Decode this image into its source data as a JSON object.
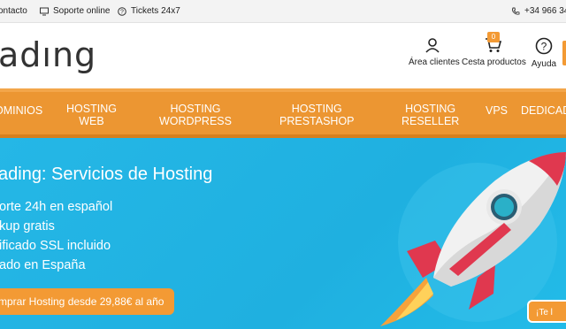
{
  "topbar": {
    "contact": "ontacto",
    "soporte": "Soporte online",
    "tickets": "Tickets 24x7",
    "phone": "+34 966 34"
  },
  "header": {
    "logo": "adıng",
    "area_clientes": "Área clientes",
    "cesta": "Cesta productos",
    "cesta_count": "0",
    "ayuda": "Ayuda"
  },
  "nav": {
    "dominios": "OMINIOS",
    "hosting_web": [
      "HOSTING",
      "WEB"
    ],
    "hosting_wp": [
      "HOSTING",
      "WORDPRESS"
    ],
    "hosting_ps": [
      "HOSTING",
      "PRESTASHOP"
    ],
    "hosting_res": [
      "HOSTING",
      "RESELLER"
    ],
    "vps": "VPS",
    "dedicados": "DEDICAD"
  },
  "hero": {
    "title": "ading: Servicios de Hosting",
    "features": [
      "orte 24h en español",
      "kup gratis",
      "ificado SSL incluido",
      "ado en España"
    ],
    "cta": "mprar Hosting desde 29,88€ al año",
    "chat": "¡Te l"
  },
  "colors": {
    "accent": "#ec9632",
    "hero_bg": "#25b7e6"
  }
}
